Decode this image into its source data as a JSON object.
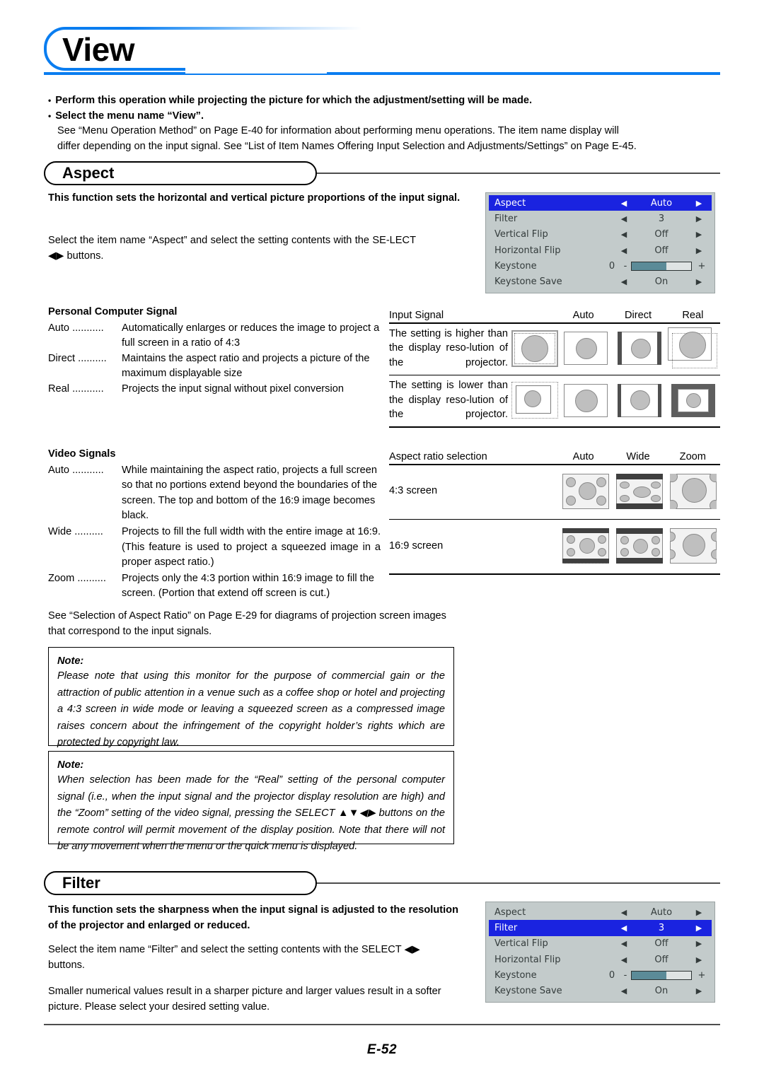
{
  "header": {
    "title": "View"
  },
  "intro": {
    "bullet1": "Perform this operation while projecting the picture for which the adjustment/setting will be made.",
    "bullet2": "Select the menu name “View”.",
    "sub_line1": "See “Menu Operation Method” on Page E-40 for information about performing menu operations. The item name display will",
    "sub_line2": "differ depending on the input signal. See “List of Item Names Offering Input Selection and Adjustments/Settings” on Page E-45."
  },
  "aspect": {
    "tab_label": "Aspect",
    "lead_bold": "This function sets the horizontal and vertical picture proportions of the input signal.",
    "instructions": "Select the item name “Aspect” and select the setting contents with the SE-LECT ◀▶ buttons.",
    "pc_signal": {
      "heading": "Personal Computer Signal",
      "rows": [
        {
          "term": "Auto ...........",
          "desc": "Automatically enlarges or reduces the image to project a full screen in a ratio of 4:3"
        },
        {
          "term": "Direct ..........",
          "desc": "Maintains the aspect ratio and projects a picture of the maximum displayable size"
        },
        {
          "term": "Real ...........",
          "desc": "Projects the input signal without pixel conversion"
        }
      ]
    },
    "video_signals": {
      "heading": "Video Signals",
      "rows": [
        {
          "term": "Auto ...........",
          "desc": "While maintaining the aspect ratio, projects a full screen so that no portions extend beyond the boundaries of the screen. The top and bottom of the 16:9 image becomes black."
        },
        {
          "term": "Wide ..........",
          "desc": "Projects to fill the full width with the entire image at 16:9. (This feature is used to project a squeezed image in a proper aspect ratio.)"
        },
        {
          "term": "Zoom ..........",
          "desc": "Projects only the 4:3 portion within 16:9 image to fill the screen. (Portion that extend off screen is cut.)"
        }
      ]
    },
    "see_also": "See “Selection of Aspect Ratio” on Page E-29 for diagrams of projection screen images that correspond to the input signals."
  },
  "pc_table": {
    "header_label": "Input Signal",
    "columns": [
      "Auto",
      "Direct",
      "Real"
    ],
    "rows": [
      {
        "caption": "The setting is higher than the display reso-lution of the projector."
      },
      {
        "caption": "The setting is lower than the display reso-lution of the projector."
      }
    ]
  },
  "aspect_table": {
    "header_label": "Aspect ratio selection",
    "columns": [
      "Auto",
      "Wide",
      "Zoom"
    ],
    "rows": [
      {
        "caption": "4:3 screen"
      },
      {
        "caption": "16:9 screen"
      }
    ]
  },
  "notes": [
    {
      "title": "Note:",
      "body": "Please note that using this monitor for the purpose of commercial gain or the attraction of public attention in a venue such as a coffee shop or hotel and projecting a 4:3 screen in wide mode or leaving a squeezed screen as a compressed image raises concern about the infringement of the copyright holder’s rights which are protected by copyright law."
    },
    {
      "title": "Note:",
      "body": "When selection has been made for the “Real” setting of the personal computer signal (i.e., when the input signal and the projector display resolution are high) and the “Zoom” setting of the video signal, pressing the SELECT ▲▼◀▶ buttons on the remote control will permit movement of the display position. Note that there will not be any movement when the menu or the quick menu is displayed."
    }
  ],
  "filter": {
    "tab_label": "Filter",
    "lead_bold": "This function sets the sharpness when the input signal is adjusted to the resolution of the projector and enlarged or reduced.",
    "instructions": "Select the item name “Filter” and select the setting contents with the SELECT ◀▶ buttons.",
    "detail": "Smaller numerical values result in a sharper picture and larger values result in a softer picture. Please select your desired setting value."
  },
  "osd_menu_aspect": {
    "selected_index": 0,
    "rows": [
      {
        "name": "Aspect",
        "value": "Auto",
        "type": "arrows",
        "left_arrow": "◀",
        "right_arrow": "▶"
      },
      {
        "name": "Filter",
        "value": "3",
        "type": "arrows",
        "left_arrow": "◀",
        "right_arrow": "▶"
      },
      {
        "name": "Vertical Flip",
        "value": "Off",
        "type": "arrows",
        "left_arrow": "◀",
        "right_arrow": "▶"
      },
      {
        "name": "Horizontal Flip",
        "value": "Off",
        "type": "arrows",
        "left_arrow": "◀",
        "right_arrow": "▶"
      },
      {
        "name": "Keystone",
        "value": "0",
        "type": "slider",
        "minus": "-",
        "plus": "+",
        "fill_percent": 58
      },
      {
        "name": "Keystone Save",
        "value": "On",
        "type": "arrows",
        "left_arrow": "◀",
        "right_arrow": "▶"
      }
    ]
  },
  "osd_menu_filter": {
    "selected_index": 1,
    "rows": [
      {
        "name": "Aspect",
        "value": "Auto",
        "type": "arrows",
        "left_arrow": "◀",
        "right_arrow": "▶"
      },
      {
        "name": "Filter",
        "value": "3",
        "type": "arrows",
        "left_arrow": "◀",
        "right_arrow": "▶"
      },
      {
        "name": "Vertical Flip",
        "value": "Off",
        "type": "arrows",
        "left_arrow": "◀",
        "right_arrow": "▶"
      },
      {
        "name": "Horizontal Flip",
        "value": "Off",
        "type": "arrows",
        "left_arrow": "◀",
        "right_arrow": "▶"
      },
      {
        "name": "Keystone",
        "value": "0",
        "type": "slider",
        "minus": "-",
        "plus": "+",
        "fill_percent": 58
      },
      {
        "name": "Keystone Save",
        "value": "On",
        "type": "arrows",
        "left_arrow": "◀",
        "right_arrow": "▶"
      }
    ]
  },
  "footer": {
    "page_number": "E-52"
  },
  "colors": {
    "accent_blue": "#0a7df0",
    "osd_background": "#c3cbcb",
    "osd_selected": "#1a23e0",
    "osd_slider_fill": "#5b8b98",
    "figure_gray": "#bfbfbf",
    "rule_gray": "#4d4d4d"
  }
}
